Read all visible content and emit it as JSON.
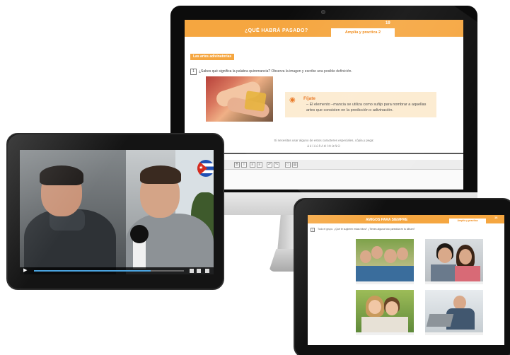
{
  "imac": {
    "page": {
      "title": "¿QUÉ HABRÁ PASADO?",
      "page_number": "19",
      "tab_label": "Amplía y practica 2",
      "section_label": "Las artes adivinatorias",
      "question_number": "1",
      "question_text": "¿Sabes qué significa la palabra quiromancia? Observa la imagen y escribe una posible definición.",
      "tip": {
        "icon": "eye-icon",
        "icon_glyph": "◉",
        "heading": "Fíjate",
        "text": "– El elemento –mancia se utiliza como sufijo para nombrar a aquellas artes que consisten en la predicción o adivinación."
      },
      "special_chars_note": "Si necesitas usar alguno de estos caracteres especiales, cópia y pega:",
      "special_chars": "áéíóúñÁÉÍÓÚÑÜ",
      "toolbar": [
        "B",
        "I",
        "≡",
        "≡",
        "↶",
        "↷",
        "▭",
        "▤"
      ]
    }
  },
  "video": {
    "flag": "cuba-flag-icon",
    "progress": 0.78,
    "play_glyph": "▶"
  },
  "photos_page": {
    "title": "AMIGOS PARA SIEMPRE",
    "page_number": "16",
    "tab_label": "Amplía y practica",
    "question_number": "1",
    "question_text": "Todo el grupo. ¿Qué te sugieren estas fotos? ¿Tienes alguna foto parecida en tu álbum?"
  },
  "colors": {
    "brand_orange": "#f5a640",
    "tip_background": "#fcebd0",
    "video_progress": "#4aa3df"
  }
}
